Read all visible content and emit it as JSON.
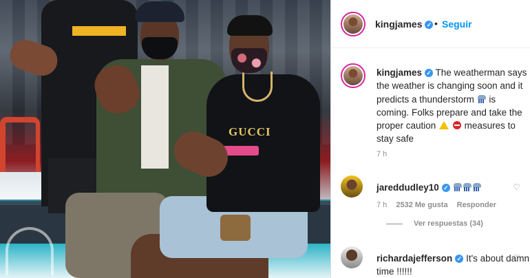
{
  "post": {
    "header": {
      "username": "kingjames",
      "separator": "•",
      "follow_label": "Seguir"
    },
    "caption": {
      "username": "kingjames",
      "text_part1": "The weatherman says the weather is changing soon and it predicts a thunderstorm ",
      "text_part2": " is coming. Folks prepare and take the proper caution ",
      "text_part3": " measures to stay safe",
      "time": "7 h"
    },
    "comments": [
      {
        "username": "jareddudley10",
        "time": "7 h",
        "likes": "2532 Me gusta",
        "reply_label": "Responder",
        "view_replies": "Ver respuestas (34)"
      },
      {
        "username": "richardajefferson",
        "text": "It's about damn time !!!!!!"
      }
    ]
  },
  "icons": {
    "verified": "verified-badge-icon",
    "heart": "heart-icon",
    "emoji": [
      "thunder-cloud-emoji",
      "warning-emoji",
      "no-entry-emoji"
    ]
  },
  "colors": {
    "link_blue": "#0095f6",
    "verified_blue": "#3897f0",
    "muted_text": "#8e8e8e",
    "border": "#dbdbdb"
  }
}
